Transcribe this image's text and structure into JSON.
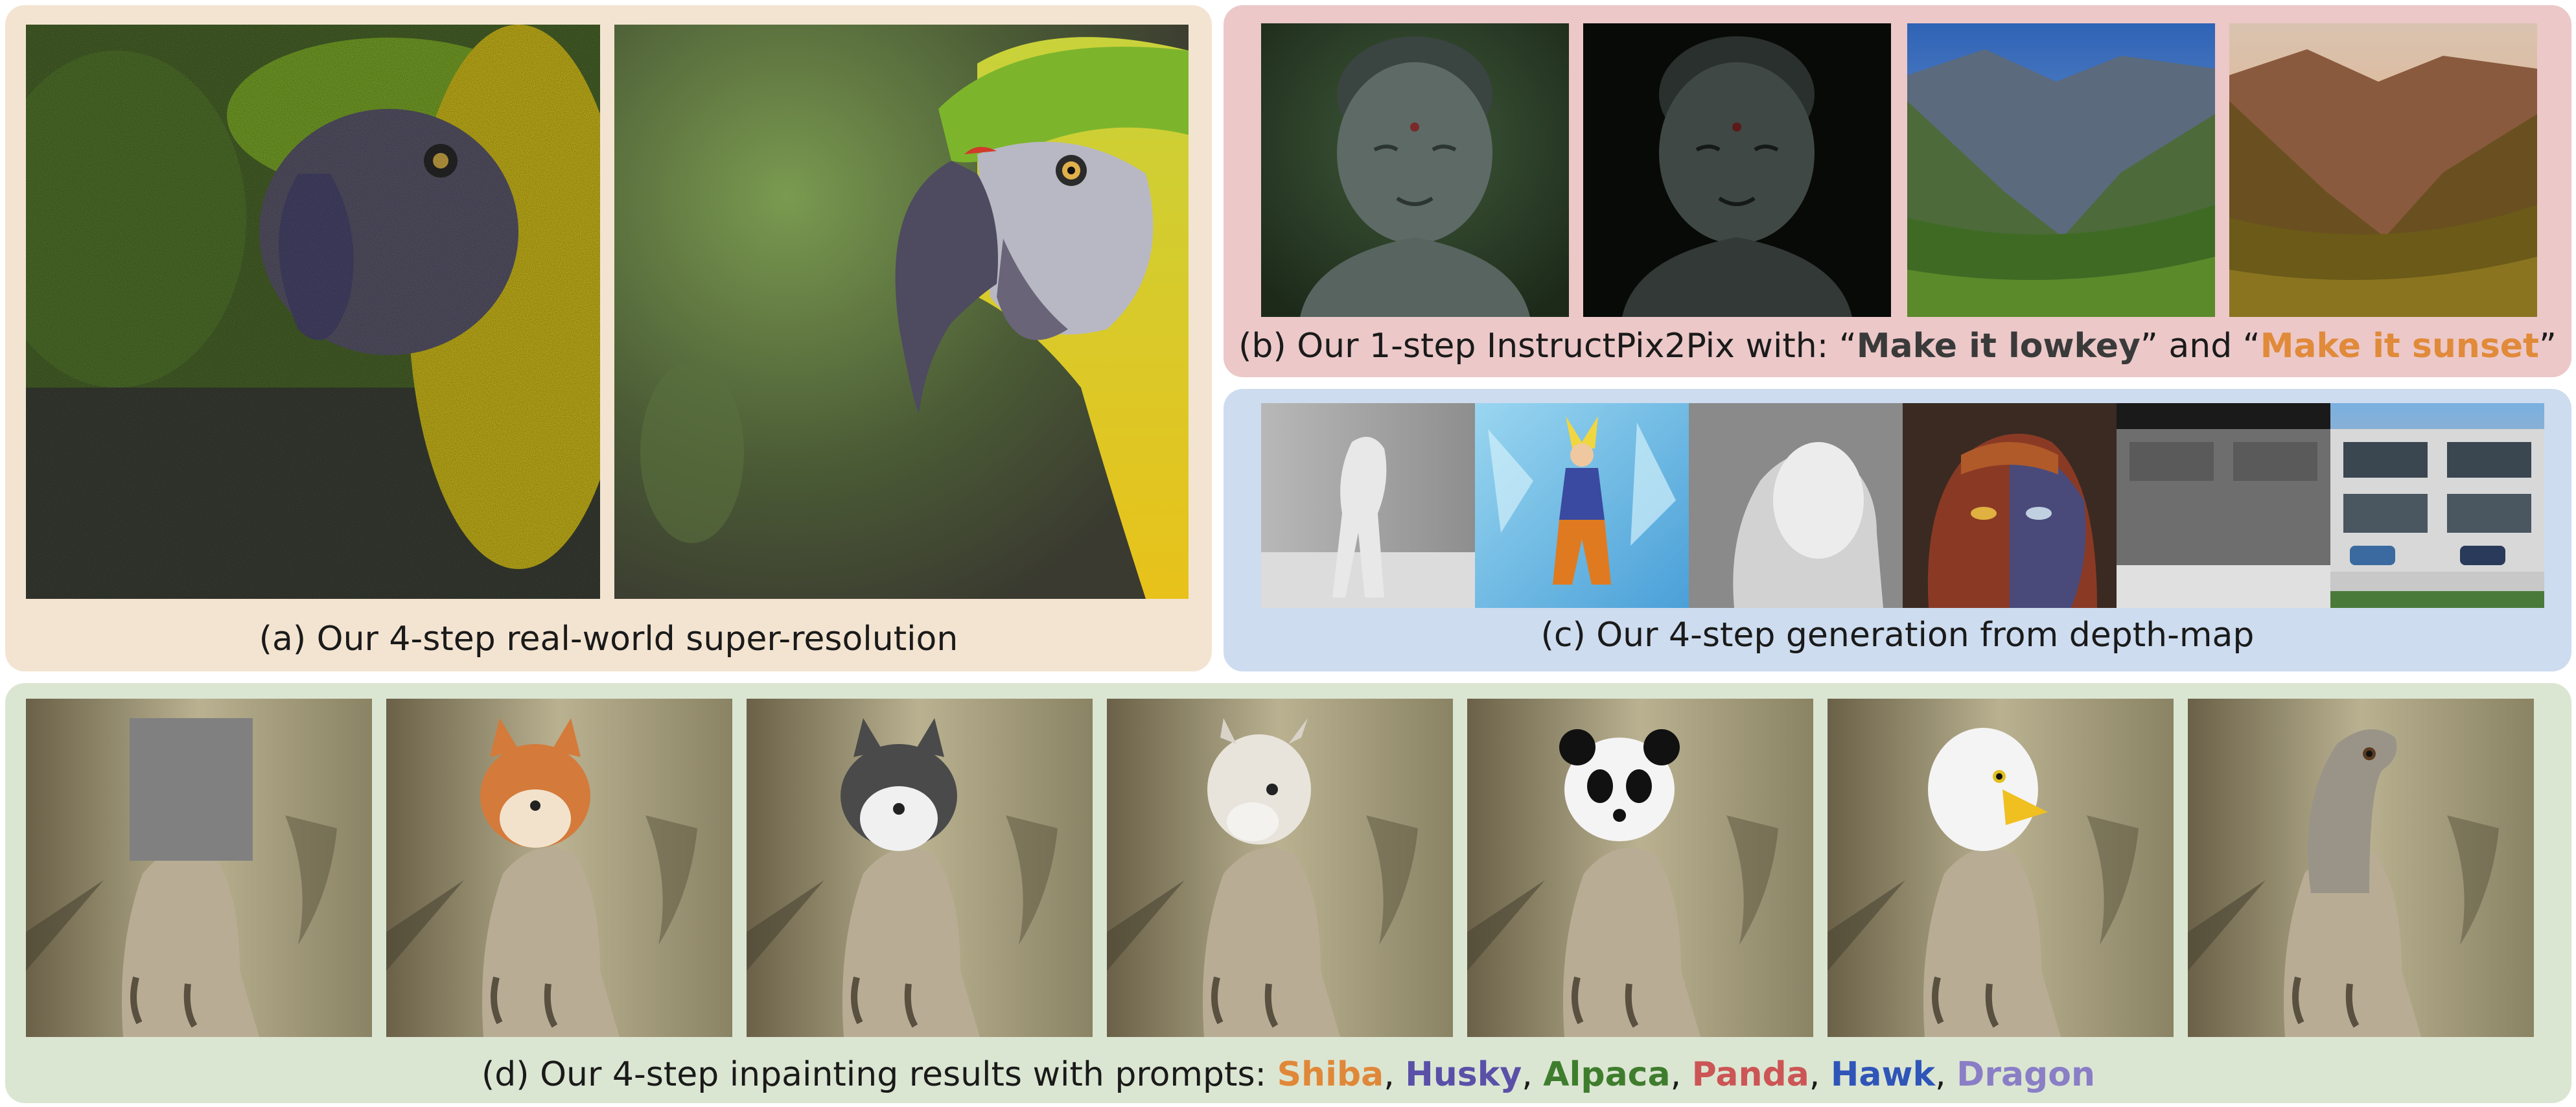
{
  "panels": {
    "a": {
      "caption": "(a) Our 4-step real-world super-resolution",
      "bg": "#f3e4d1"
    },
    "b": {
      "caption_prefix": "(b) Our 1-step InstructPix2Pix with: ",
      "quote_open_1": "“",
      "prompt_1": "Make it lowkey",
      "quote_close_1": "”",
      "joiner": " and ",
      "quote_open_2": "“",
      "prompt_2": "Make it sunset",
      "quote_close_2": "”",
      "prompt_1_color": "#3a3a3a",
      "prompt_2_color": "#e08a3a",
      "bg": "#ecc8c8"
    },
    "c": {
      "caption": "(c) Our 4-step generation from depth-map",
      "bg": "#cddcef"
    },
    "d": {
      "caption_prefix": "(d) Our 4-step inpainting results with prompts: ",
      "prompts": [
        {
          "text": "Shiba",
          "color": "#e0883a"
        },
        {
          "text": "Husky",
          "color": "#5a50a8"
        },
        {
          "text": "Alpaca",
          "color": "#3f7d2e"
        },
        {
          "text": "Panda",
          "color": "#cc5555"
        },
        {
          "text": "Hawk",
          "color": "#2f55b8"
        },
        {
          "text": "Dragon",
          "color": "#8a7ec6"
        }
      ],
      "separator": ", ",
      "bg": "#dbe6d2"
    }
  }
}
